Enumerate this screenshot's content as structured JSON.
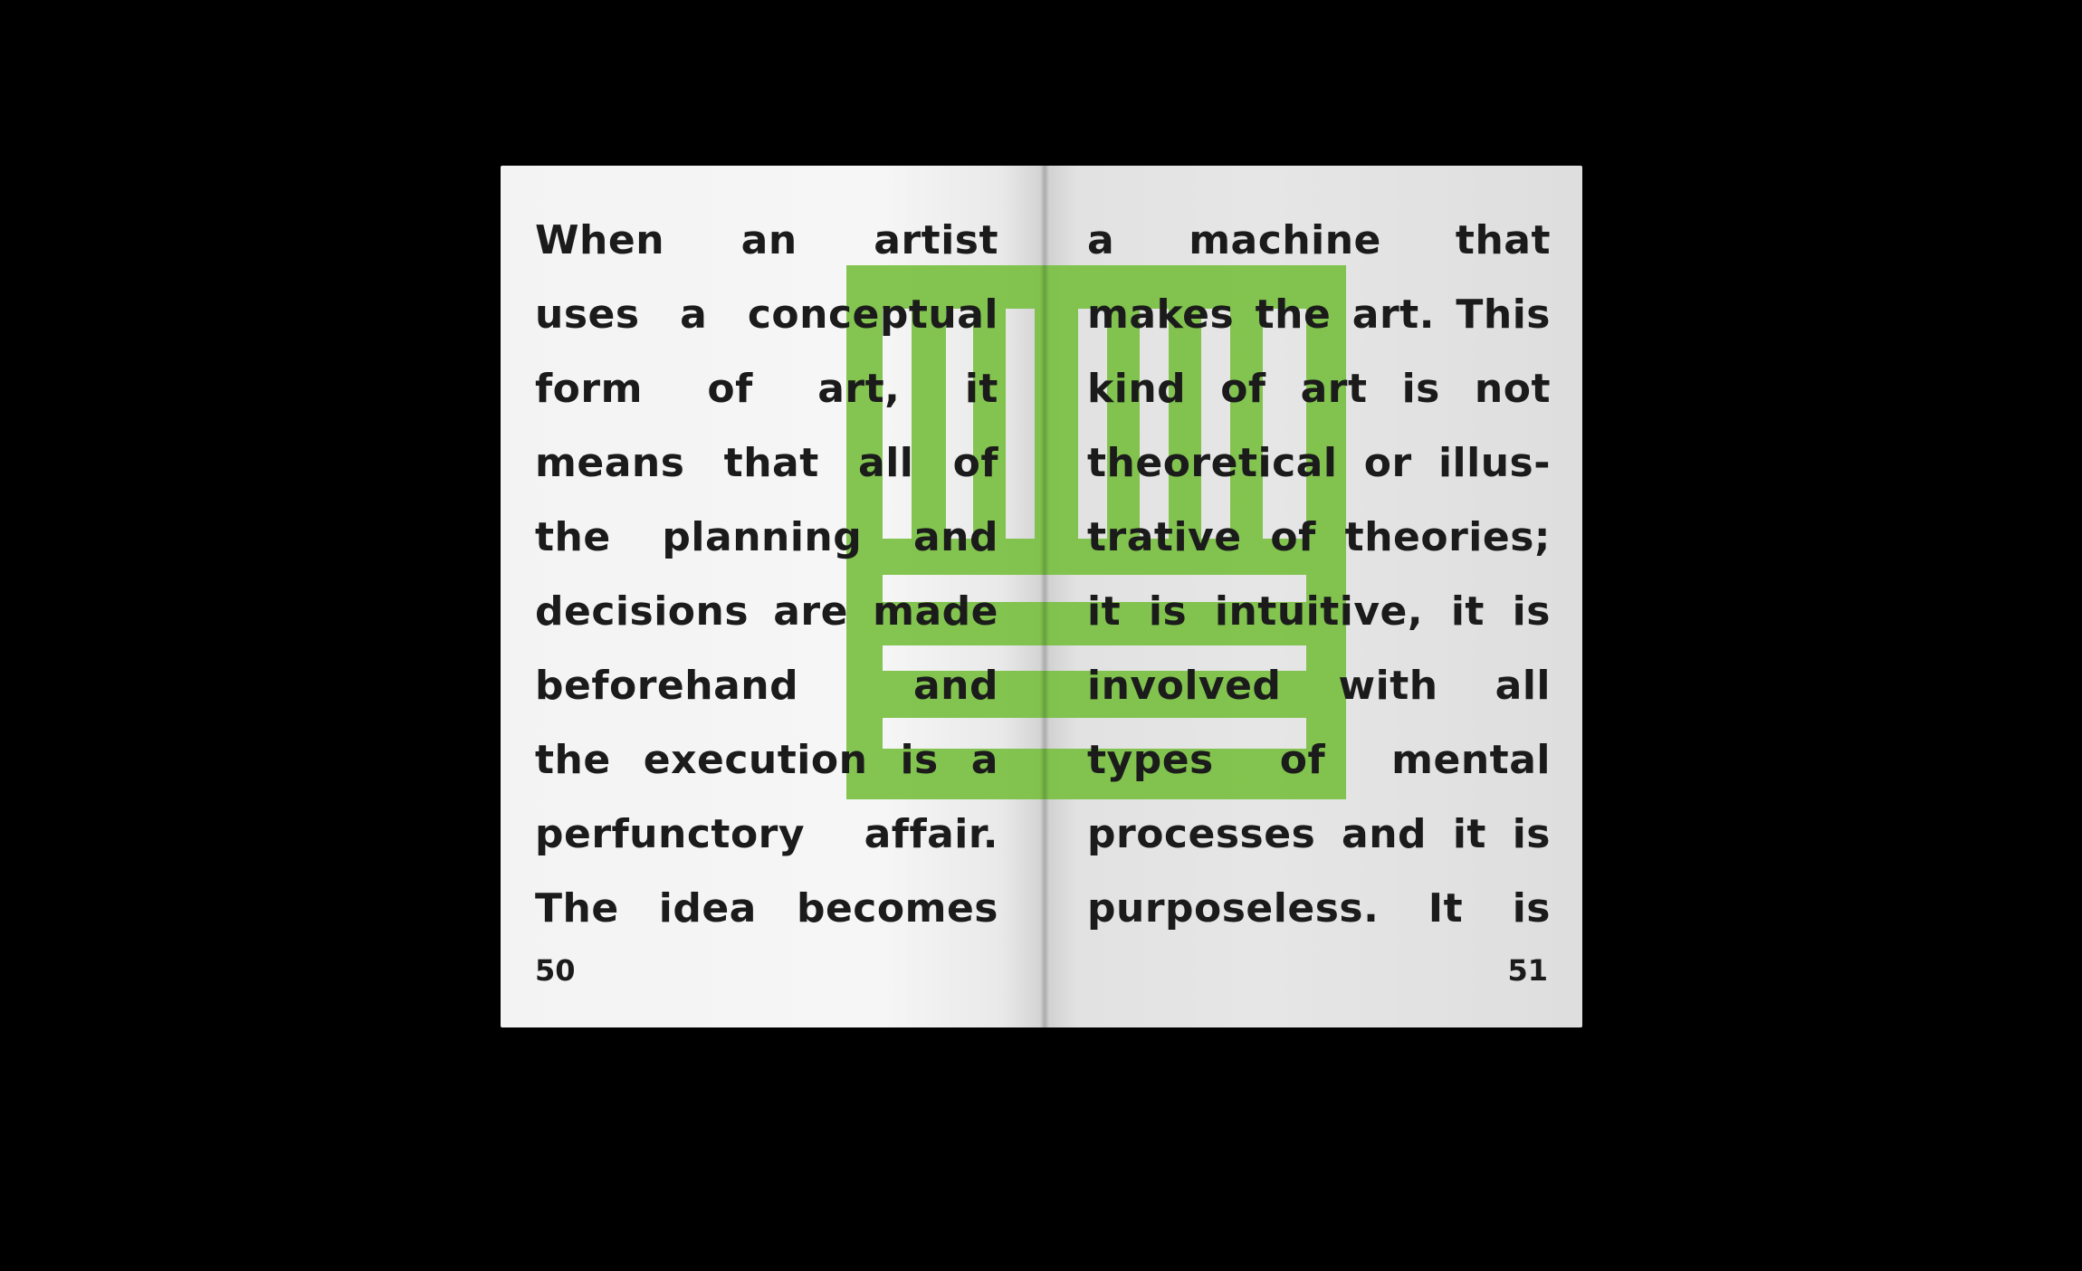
{
  "booklet": {
    "left_page": {
      "lines": [
        [
          "When",
          "an",
          "artist"
        ],
        [
          "uses",
          "a",
          "conceptual"
        ],
        [
          "form",
          "of",
          "art,",
          "it"
        ],
        [
          "means",
          "that",
          "all",
          "of"
        ],
        [
          "the",
          "planning",
          "and"
        ],
        [
          "decisions",
          "are",
          "made"
        ],
        [
          "beforehand",
          "and"
        ],
        [
          "the",
          "execution",
          "is",
          "a"
        ],
        [
          "perfunctory",
          "affair."
        ],
        [
          "The",
          "idea",
          "becomes"
        ]
      ],
      "page_number": "50"
    },
    "right_page": {
      "lines": [
        [
          "a",
          "machine",
          "that"
        ],
        [
          "makes",
          "the",
          "art.",
          "This"
        ],
        [
          "kind",
          "of",
          "art",
          "is",
          "not"
        ],
        [
          "theoretical",
          "or",
          "illus-"
        ],
        [
          "trative",
          "of",
          "theories;"
        ],
        [
          "it",
          "is",
          "intuitive,",
          "it",
          "is"
        ],
        [
          "involved",
          "with",
          "all"
        ],
        [
          "types",
          "of",
          "mental"
        ],
        [
          "processes",
          "and",
          "it",
          "is"
        ],
        [
          "purposeless.",
          "It",
          "is"
        ]
      ],
      "page_number": "51"
    },
    "graphic": {
      "icon": "green-grid-emblem",
      "color": "#7ac143"
    }
  }
}
